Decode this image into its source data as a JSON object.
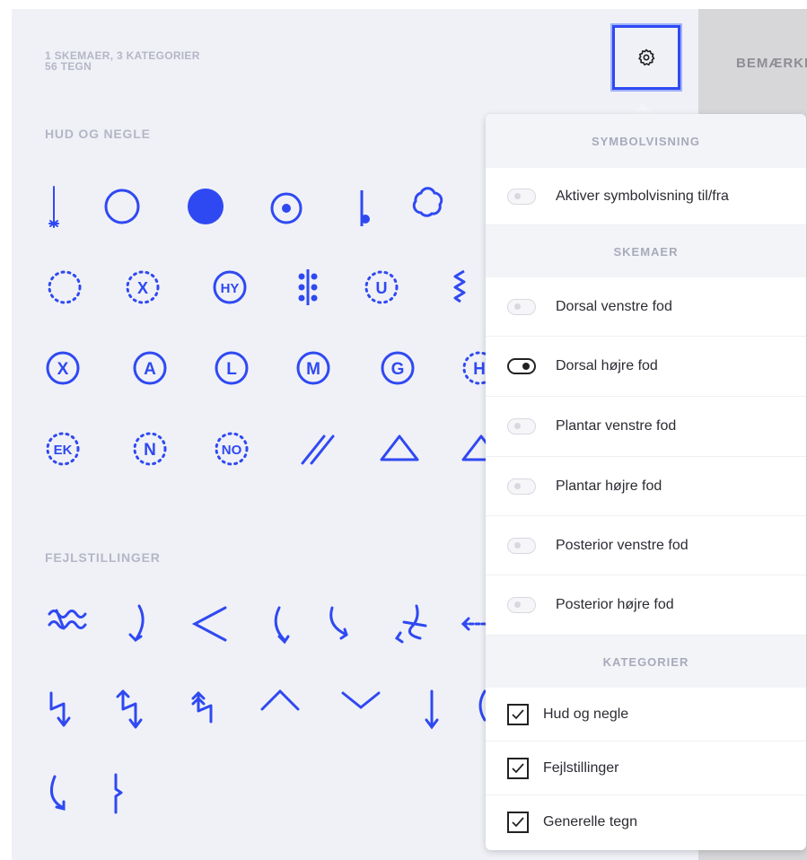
{
  "summary": {
    "line1": "1 SKEMAER, 3 KATEGORIER",
    "line2": "56 TEGN"
  },
  "tab": {
    "notes_label": "BEMÆRKNINGER"
  },
  "sections": {
    "hud": "HUD OG NEGLE",
    "fejl": "FEJLSTILLINGER"
  },
  "panel": {
    "symbolvisning_header": "SYMBOLVISNING",
    "toggle_all_label": "Aktiver symbolvisning til/fra",
    "skemaer_header": "SKEMAER",
    "skemaer": [
      {
        "label": "Dorsal venstre fod",
        "on": false
      },
      {
        "label": "Dorsal højre fod",
        "on": true
      },
      {
        "label": "Plantar venstre fod",
        "on": false
      },
      {
        "label": "Plantar højre fod",
        "on": false
      },
      {
        "label": "Posterior venstre fod",
        "on": false
      },
      {
        "label": "Posterior højre fod",
        "on": false
      }
    ],
    "kategorier_header": "KATEGORIER",
    "kategorier": [
      {
        "label": "Hud og negle",
        "checked": true
      },
      {
        "label": "Fejlstillinger",
        "checked": true
      },
      {
        "label": "Generelle tegn",
        "checked": true
      }
    ]
  },
  "symbol_letters": {
    "hy": "HY",
    "u": "U",
    "x": "X",
    "a": "A",
    "l": "L",
    "m": "M",
    "g": "G",
    "h": "H",
    "ek": "EK",
    "n": "N",
    "no": "NO"
  },
  "colors": {
    "accent": "#2f49f2",
    "background": "#f0f1f7"
  }
}
